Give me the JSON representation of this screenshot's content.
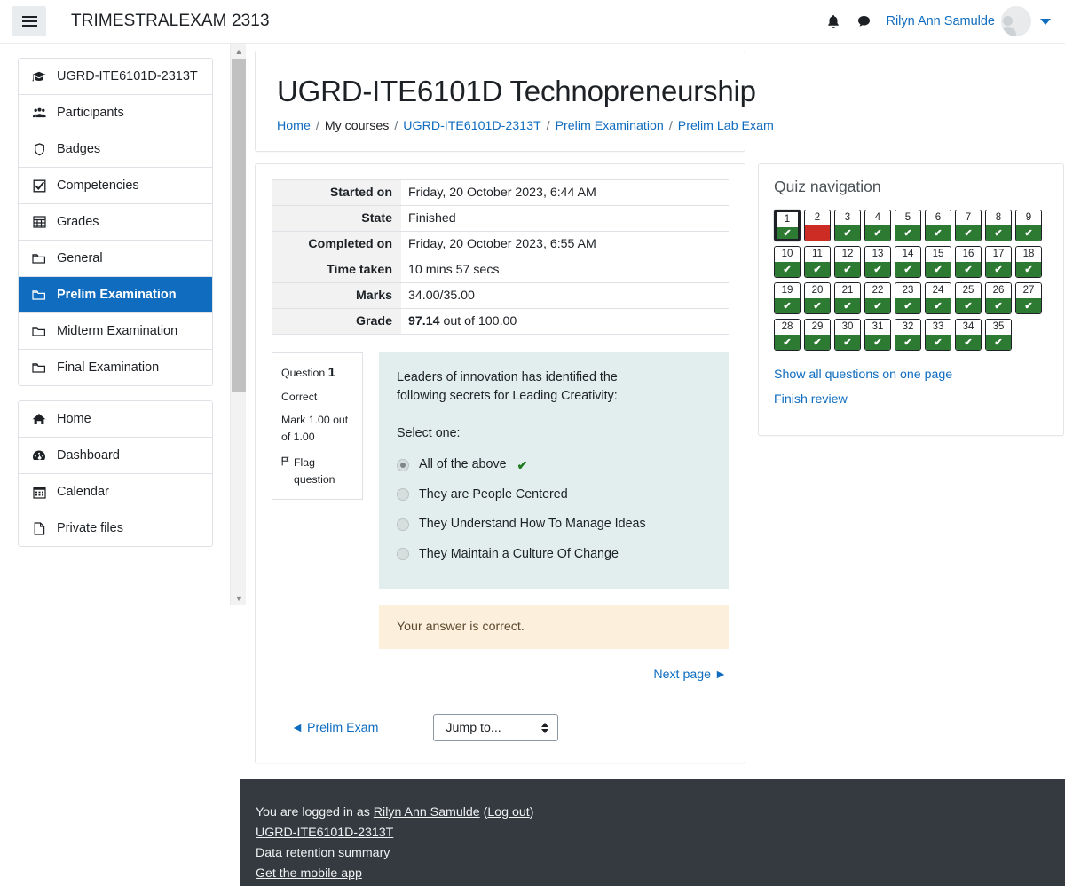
{
  "navbar": {
    "menu_icon": "hamburger-icon",
    "brand_title": "TRIMESTRALEXAM 2313",
    "notifications_icon": "bell-icon",
    "messages_icon": "message-bubble-icon",
    "user_name": "Rilyn Ann Samulde",
    "avatar_icon": "user-avatar",
    "caret_icon": "chevron-down-icon"
  },
  "sidebar": {
    "groups": [
      {
        "items": [
          {
            "label": "UGRD-ITE6101D-2313T",
            "icon": "graduation-cap-icon",
            "active": false
          },
          {
            "label": "Participants",
            "icon": "users-icon",
            "active": false
          },
          {
            "label": "Badges",
            "icon": "shield-icon",
            "active": false
          },
          {
            "label": "Competencies",
            "icon": "check-square-icon",
            "active": false
          },
          {
            "label": "Grades",
            "icon": "table-grid-icon",
            "active": false
          },
          {
            "label": "General",
            "icon": "folder-icon",
            "active": false
          },
          {
            "label": "Prelim Examination",
            "icon": "folder-icon",
            "active": true
          },
          {
            "label": "Midterm Examination",
            "icon": "folder-icon",
            "active": false
          },
          {
            "label": "Final Examination",
            "icon": "folder-icon",
            "active": false
          }
        ]
      },
      {
        "items": [
          {
            "label": "Home",
            "icon": "home-icon",
            "active": false
          },
          {
            "label": "Dashboard",
            "icon": "dashboard-icon",
            "active": false
          },
          {
            "label": "Calendar",
            "icon": "calendar-icon",
            "active": false
          },
          {
            "label": "Private files",
            "icon": "file-icon",
            "active": false
          }
        ]
      }
    ]
  },
  "header": {
    "page_title": "UGRD-ITE6101D Technopreneurship",
    "breadcrumb": [
      {
        "label": "Home",
        "link": true
      },
      {
        "label": "My courses",
        "link": false
      },
      {
        "label": "UGRD-ITE6101D-2313T",
        "link": true
      },
      {
        "label": "Prelim Examination",
        "link": true
      },
      {
        "label": "Prelim Lab Exam",
        "link": true
      }
    ],
    "breadcrumb_separator": "/"
  },
  "summary": {
    "rows": [
      {
        "label": "Started on",
        "value": "Friday, 20 October 2023, 6:44 AM",
        "bold_value": ""
      },
      {
        "label": "State",
        "value": "Finished",
        "bold_value": ""
      },
      {
        "label": "Completed on",
        "value": "Friday, 20 October 2023, 6:55 AM",
        "bold_value": ""
      },
      {
        "label": "Time taken",
        "value": "10 mins 57 secs",
        "bold_value": ""
      },
      {
        "label": "Marks",
        "value": "34.00/35.00",
        "bold_value": ""
      },
      {
        "label": "Grade",
        "value": " out of 100.00",
        "bold_value": "97.14"
      }
    ]
  },
  "question": {
    "info": {
      "question_word": "Question",
      "number": "1",
      "state": "Correct",
      "mark": "Mark 1.00 out of 1.00",
      "flag_icon": "flag-icon",
      "flag_label": "Flag question"
    },
    "text": "Leaders of innovation has identified the following secrets for Leading Creativity:",
    "select_prompt": "Select one:",
    "options": [
      {
        "label": "All of the above",
        "selected": true,
        "correct_mark": "✔"
      },
      {
        "label": "They are People Centered",
        "selected": false,
        "correct_mark": ""
      },
      {
        "label": "They Understand How To Manage Ideas",
        "selected": false,
        "correct_mark": ""
      },
      {
        "label": "They Maintain a Culture Of Change",
        "selected": false,
        "correct_mark": ""
      }
    ],
    "feedback": "Your answer is correct.",
    "next_page_label": "Next page ►"
  },
  "bottom_nav": {
    "prev_label": "◄ Prelim Exam",
    "jump_to_value": "Jump to...",
    "stepper_icon": "up-down-stepper-icon"
  },
  "quiz_navigation": {
    "heading": "Quiz navigation",
    "check_glyph": "✔",
    "questions": [
      {
        "n": "1",
        "state": "correct",
        "current": true
      },
      {
        "n": "2",
        "state": "incorrect",
        "current": false
      },
      {
        "n": "3",
        "state": "correct",
        "current": false
      },
      {
        "n": "4",
        "state": "correct",
        "current": false
      },
      {
        "n": "5",
        "state": "correct",
        "current": false
      },
      {
        "n": "6",
        "state": "correct",
        "current": false
      },
      {
        "n": "7",
        "state": "correct",
        "current": false
      },
      {
        "n": "8",
        "state": "correct",
        "current": false
      },
      {
        "n": "9",
        "state": "correct",
        "current": false
      },
      {
        "n": "10",
        "state": "correct",
        "current": false
      },
      {
        "n": "11",
        "state": "correct",
        "current": false
      },
      {
        "n": "12",
        "state": "correct",
        "current": false
      },
      {
        "n": "13",
        "state": "correct",
        "current": false
      },
      {
        "n": "14",
        "state": "correct",
        "current": false
      },
      {
        "n": "15",
        "state": "correct",
        "current": false
      },
      {
        "n": "16",
        "state": "correct",
        "current": false
      },
      {
        "n": "17",
        "state": "correct",
        "current": false
      },
      {
        "n": "18",
        "state": "correct",
        "current": false
      },
      {
        "n": "19",
        "state": "correct",
        "current": false
      },
      {
        "n": "20",
        "state": "correct",
        "current": false
      },
      {
        "n": "21",
        "state": "correct",
        "current": false
      },
      {
        "n": "22",
        "state": "correct",
        "current": false
      },
      {
        "n": "23",
        "state": "correct",
        "current": false
      },
      {
        "n": "24",
        "state": "correct",
        "current": false
      },
      {
        "n": "25",
        "state": "correct",
        "current": false
      },
      {
        "n": "26",
        "state": "correct",
        "current": false
      },
      {
        "n": "27",
        "state": "correct",
        "current": false
      },
      {
        "n": "28",
        "state": "correct",
        "current": false
      },
      {
        "n": "29",
        "state": "correct",
        "current": false
      },
      {
        "n": "30",
        "state": "correct",
        "current": false
      },
      {
        "n": "31",
        "state": "correct",
        "current": false
      },
      {
        "n": "32",
        "state": "correct",
        "current": false
      },
      {
        "n": "33",
        "state": "correct",
        "current": false
      },
      {
        "n": "34",
        "state": "correct",
        "current": false
      },
      {
        "n": "35",
        "state": "correct",
        "current": false
      }
    ],
    "links": [
      "Show all questions on one page",
      "Finish review"
    ]
  },
  "footer": {
    "logged_in_prefix": "You are logged in as ",
    "logged_in_user": "Rilyn Ann Samulde",
    "open_paren": " (",
    "logout_label": "Log out",
    "close_paren": ")",
    "links": [
      "UGRD-ITE6101D-2313T",
      "Data retention summary",
      "Get the mobile app"
    ]
  },
  "colors": {
    "accent_blue": "#0f6cbf",
    "correct_green": "#2d7a33",
    "incorrect_red": "#cc2c24",
    "question_bg": "#e2eeee",
    "feedback_bg": "#fcefdc",
    "footer_bg": "#343a40"
  }
}
